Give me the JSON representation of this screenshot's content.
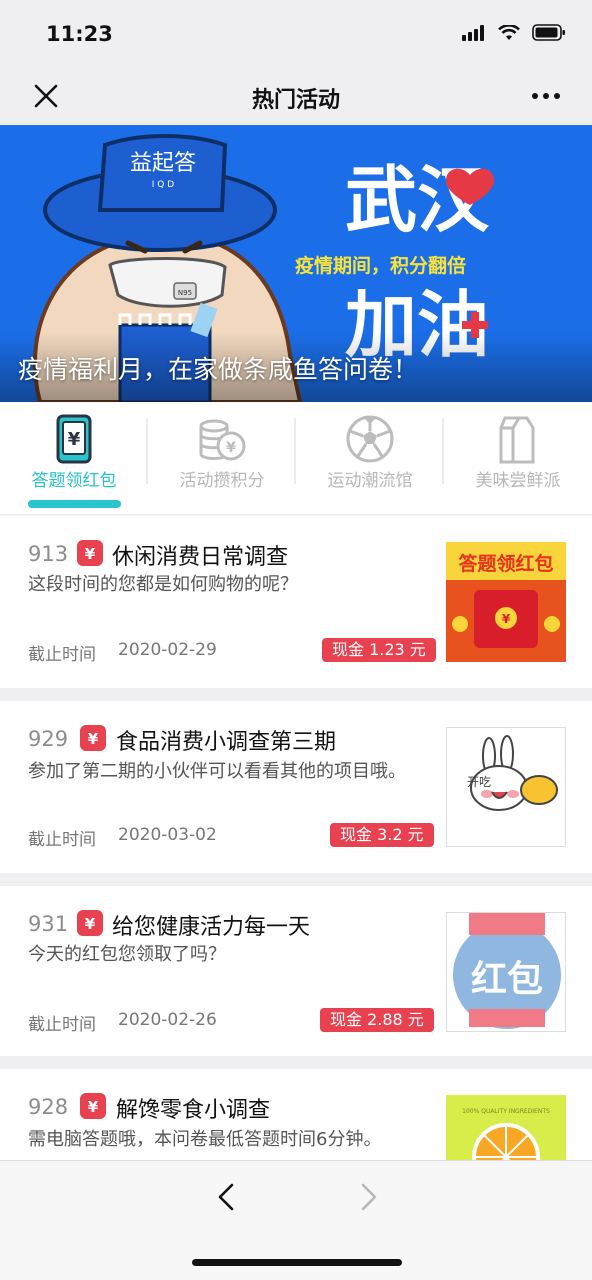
{
  "status": {
    "time": "11:23"
  },
  "navbar": {
    "title": "热门活动"
  },
  "banner": {
    "caption": "疫情福利月，在家做条咸鱼答问卷！",
    "hat_text": "益起答",
    "hat_sub": "I Q D",
    "mask_label": "N95",
    "slogan_top": "武汉",
    "slogan_mid": "疫情期间，积分翻倍",
    "slogan_bottom": "加油"
  },
  "tabs": [
    {
      "label": "答题领红包",
      "icon": "red-packet-phone-icon",
      "active": true
    },
    {
      "label": "活动攒积分",
      "icon": "coin-stack-icon",
      "active": false
    },
    {
      "label": "运动潮流馆",
      "icon": "soccer-ball-icon",
      "active": false
    },
    {
      "label": "美味尝鲜派",
      "icon": "milk-carton-icon",
      "active": false
    }
  ],
  "badge_symbol": "¥",
  "deadline_label": "截止时间",
  "cards": [
    {
      "id": "913",
      "title": "休闲消费日常调查",
      "desc": "这段时间的您都是如何购物的呢？",
      "date": "2020-02-29",
      "reward": "现金 1.23 元",
      "thumb_text": "答题领红包",
      "thumb_symbol": "¥"
    },
    {
      "id": "929",
      "title": "食品消费小调查第三期",
      "desc": "参加了第二期的小伙伴可以看看其他的项目哦。",
      "date": "2020-03-02",
      "reward": "现金 3.2 元",
      "thumb_text": "开吃"
    },
    {
      "id": "931",
      "title": "给您健康活力每一天",
      "desc": "今天的红包您领取了吗？",
      "date": "2020-02-26",
      "reward": "现金 2.88 元",
      "thumb_text": "红包"
    },
    {
      "id": "928",
      "title": "解馋零食小调查",
      "desc": "需电脑答题哦，本问卷最低答题时间6分钟。",
      "thumb_text": "100% QUALITY INGREDIENTS"
    }
  ],
  "colors": {
    "accent": "#28c6cc",
    "brand_red": "#e8414f",
    "banner_blue": "#1b6ee8"
  }
}
